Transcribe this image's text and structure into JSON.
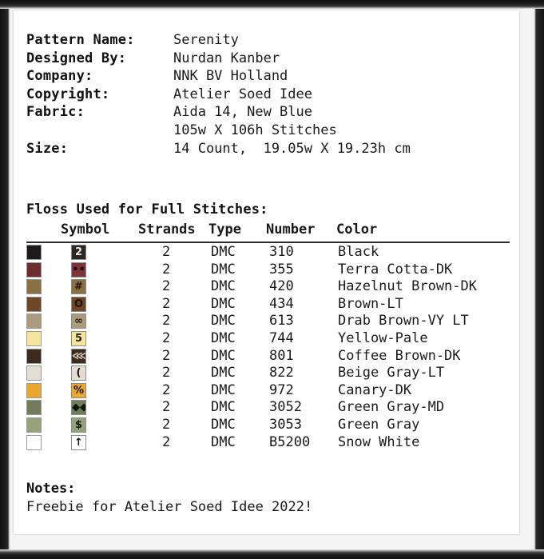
{
  "document": {
    "info_rows": [
      {
        "label": "Pattern Name:",
        "value": "Serenity"
      },
      {
        "label": "Designed By:",
        "value": "Nurdan Kanber"
      },
      {
        "label": "Company:",
        "value": "NNK BV Holland"
      },
      {
        "label": "Copyright:",
        "value": "Atelier Soed Idee"
      },
      {
        "label": "Fabric:",
        "value": "Aida 14, New Blue"
      },
      {
        "label": "",
        "value": "105w X 106h Stitches"
      },
      {
        "label": "Size:",
        "value": "14 Count,  19.05w X 19.23h cm"
      }
    ]
  },
  "floss": {
    "section_title": "Floss Used for Full Stitches:",
    "columns": {
      "symbol": "Symbol",
      "strands": "Strands",
      "type": "Type",
      "number": "Number",
      "color": "Color"
    },
    "rows": [
      {
        "swatch": "#1c1a1a",
        "symbol_glyph": "2",
        "symbol_bg": "#2a2724",
        "symbol_fg": "#e8e6e2",
        "strands": "2",
        "type": "DMC",
        "number": "310",
        "color": "Black"
      },
      {
        "swatch": "#6e2b30",
        "symbol_glyph": "••",
        "symbol_bg": "#7d3338",
        "symbol_fg": "#1a1212",
        "strands": "2",
        "type": "DMC",
        "number": "355",
        "color": "Terra Cotta-DK"
      },
      {
        "swatch": "#8a6f43",
        "symbol_glyph": "#",
        "symbol_bg": "#8a6f43",
        "symbol_fg": "#221a0e",
        "strands": "2",
        "type": "DMC",
        "number": "420",
        "color": "Hazelnut Brown-DK"
      },
      {
        "swatch": "#6f4626",
        "symbol_glyph": "O",
        "symbol_bg": "#6f4626",
        "symbol_fg": "#1c120a",
        "strands": "2",
        "type": "DMC",
        "number": "434",
        "color": "Brown-LT"
      },
      {
        "swatch": "#ab9a7c",
        "symbol_glyph": "∞",
        "symbol_bg": "#ab9a7c",
        "symbol_fg": "#221d14",
        "strands": "2",
        "type": "DMC",
        "number": "613",
        "color": "Drab Brown-VY LT"
      },
      {
        "swatch": "#f6e69c",
        "symbol_glyph": "5",
        "symbol_bg": "#f6e69c",
        "symbol_fg": "#25210f",
        "strands": "2",
        "type": "DMC",
        "number": "744",
        "color": "Yellow-Pale"
      },
      {
        "swatch": "#3c2b1f",
        "symbol_glyph": "⋘",
        "symbol_bg": "#3c2b1f",
        "symbol_fg": "#d8d2c8",
        "strands": "2",
        "type": "DMC",
        "number": "801",
        "color": "Coffee Brown-DK"
      },
      {
        "swatch": "#e2ded4",
        "symbol_glyph": "(",
        "symbol_bg": "#e2ded4",
        "symbol_fg": "#15130f",
        "strands": "2",
        "type": "DMC",
        "number": "822",
        "color": "Beige Gray-LT"
      },
      {
        "swatch": "#eaa72c",
        "symbol_glyph": "%",
        "symbol_bg": "#eaa72c",
        "symbol_fg": "#1d1406",
        "strands": "2",
        "type": "DMC",
        "number": "972",
        "color": "Canary-DK"
      },
      {
        "swatch": "#717c58",
        "symbol_glyph": "◆◆",
        "symbol_bg": "#717c58",
        "symbol_fg": "#12150c",
        "strands": "2",
        "type": "DMC",
        "number": "3052",
        "color": "Green Gray-MD"
      },
      {
        "swatch": "#96a27a",
        "symbol_glyph": "$",
        "symbol_bg": "#96a27a",
        "symbol_fg": "#14170e",
        "strands": "2",
        "type": "DMC",
        "number": "3053",
        "color": "Green Gray"
      },
      {
        "swatch": "#ffffff",
        "symbol_glyph": "↑",
        "symbol_bg": "#ffffff",
        "symbol_fg": "#101010",
        "strands": "2",
        "type": "DMC",
        "number": "B5200",
        "color": "Snow White"
      }
    ]
  },
  "notes": {
    "title": "Notes:",
    "body": "Freebie for Atelier Soed Idee 2022!"
  }
}
